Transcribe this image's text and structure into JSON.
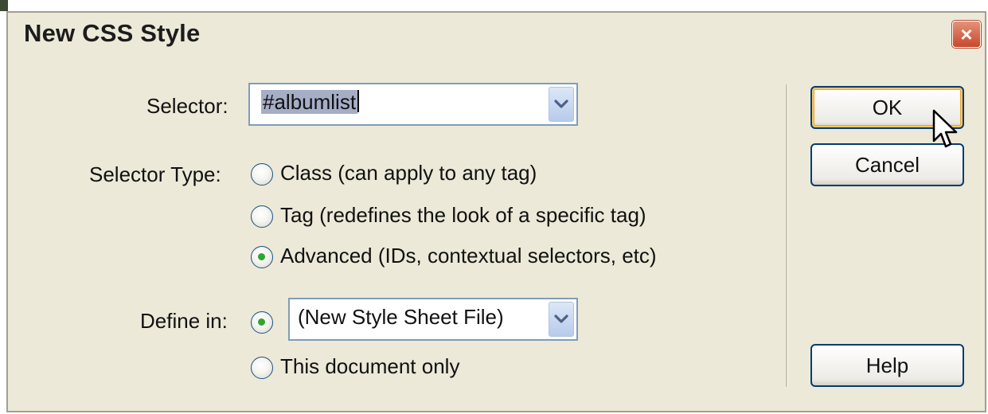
{
  "dialog": {
    "title": "New CSS Style",
    "close_label": "×"
  },
  "selector": {
    "label": "Selector:",
    "value": "#albumlist"
  },
  "selector_type": {
    "label": "Selector Type:",
    "options": [
      {
        "label": "Class (can apply to any tag)",
        "checked": false
      },
      {
        "label": "Tag (redefines the look of a specific tag)",
        "checked": false
      },
      {
        "label": "Advanced (IDs, contextual selectors, etc)",
        "checked": true
      }
    ]
  },
  "define_in": {
    "label": "Define in:",
    "combo_value": "(New Style Sheet File)",
    "other_option": "This document only",
    "combo_checked": true,
    "other_checked": false
  },
  "buttons": {
    "ok": "OK",
    "cancel": "Cancel",
    "help": "Help"
  },
  "colors": {
    "dialog_bg": "#ece9d8",
    "radio_dot": "#2fa62f",
    "button_border": "#003c74",
    "close_button": "#c7482b"
  }
}
